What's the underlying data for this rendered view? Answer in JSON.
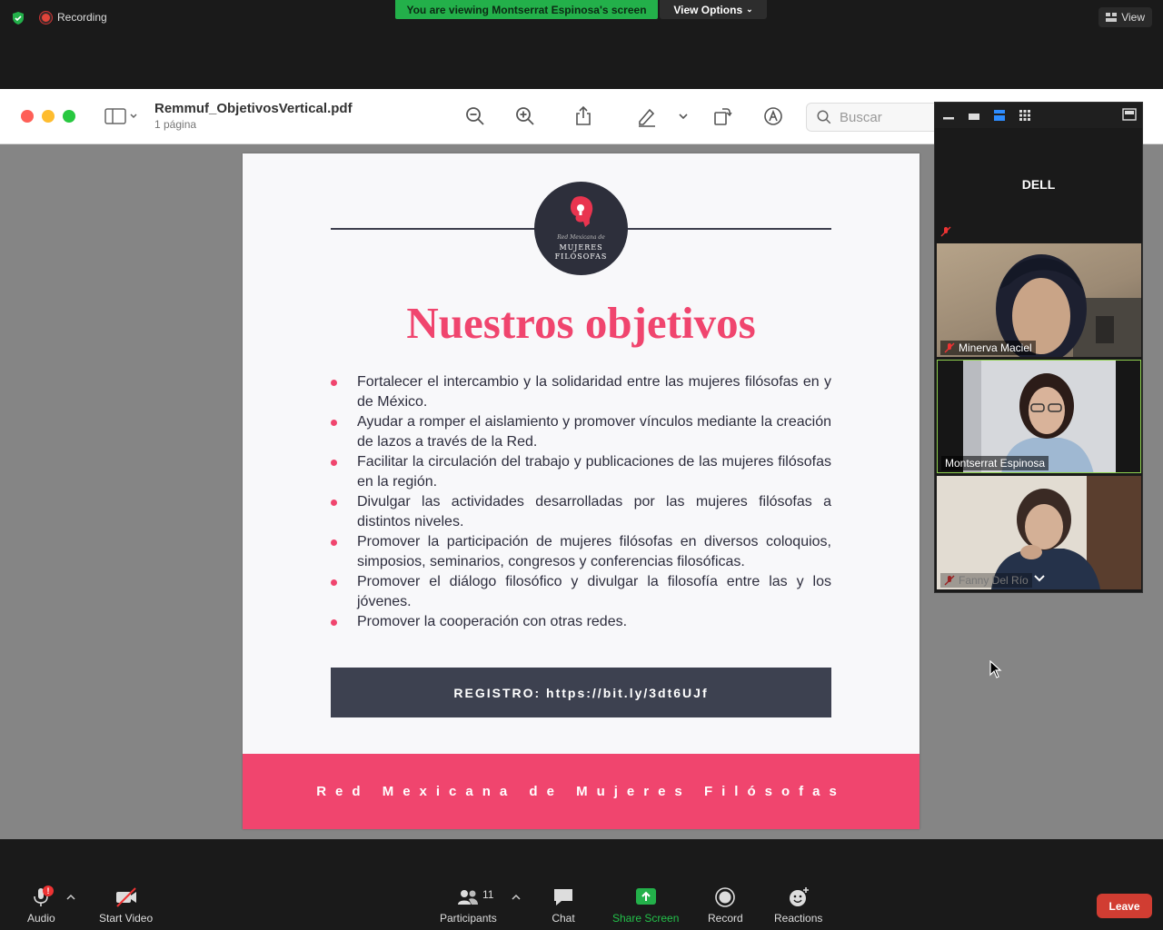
{
  "zoom": {
    "recording_label": "Recording",
    "viewing_banner": "You are viewing Montserrat Espinosa's screen",
    "view_options_label": "View Options",
    "top_view_label": "View"
  },
  "document": {
    "filename": "Remmuf_ObjetivosVertical.pdf",
    "pages": "1 página",
    "search_placeholder": "Buscar"
  },
  "page": {
    "logo_line1": "Red Mexicana de",
    "logo_line2": "MUJERES",
    "logo_line3": "FILÓSOFAS",
    "title": "Nuestros objetivos",
    "objectives": [
      "Fortalecer el intercambio y la solidaridad entre las mujeres filósofas en y de México.",
      "Ayudar a romper el aislamiento y promover vínculos mediante la creación de lazos a través de la Red.",
      "Facilitar la circulación del trabajo y publicaciones de las mujeres filósofas en la región.",
      "Divulgar las actividades desarrolladas por las mujeres filósofas a distintos niveles.",
      "Promover la participación de mujeres filósofas en diversos coloquios, simposios, seminarios, congresos y conferencias filosóficas.",
      "Promover el diálogo filosófico y divulgar la filosofía entre las y los jóvenes.",
      "Promover la cooperación con otras redes."
    ],
    "registro": "REGISTRO: https://bit.ly/3dt6UJf",
    "footer": "Red Mexicana de Mujeres Filósofas"
  },
  "gallery": {
    "host_name": "DELL",
    "participants": [
      {
        "name": "Minerva Maciel"
      },
      {
        "name": "Montserrat Espinosa"
      },
      {
        "name": "Fanny Del Río"
      }
    ]
  },
  "toolbar": {
    "audio": "Audio",
    "audio_badge": "!",
    "start_video": "Start Video",
    "participants": "Participants",
    "participants_count": "11",
    "chat": "Chat",
    "share_screen": "Share Screen",
    "record": "Record",
    "reactions": "Reactions",
    "leave": "Leave"
  },
  "colors": {
    "accent_pink": "#f0456e",
    "share_green": "#23b04a",
    "leave_red": "#d13d32",
    "registro_bg": "#3d4150"
  }
}
